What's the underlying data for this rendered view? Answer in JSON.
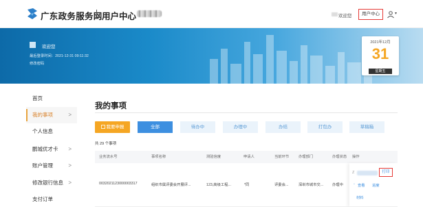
{
  "header": {
    "brand": "广东政务服务网",
    "section": "用户中心",
    "welcome": "欢迎您",
    "user_center_button": "用户中心",
    "caret": "▾"
  },
  "banner": {
    "greeting": "欢迎您",
    "last_login": "最后登录时间：2021-12-31 09:11:32",
    "change_password": "修改密码",
    "calendar": {
      "month": "2021年12月",
      "day": "31",
      "weekday": "星期五"
    }
  },
  "sidebar": {
    "items": [
      {
        "label": "首页",
        "arrow": ""
      },
      {
        "label": "我的事项",
        "arrow": ">"
      },
      {
        "label": "个人信息",
        "arrow": ""
      },
      {
        "label": "鹏城优才卡",
        "arrow": ">"
      },
      {
        "label": "账户管理",
        "arrow": ">"
      },
      {
        "label": "修改银行信息",
        "arrow": ">"
      },
      {
        "label": "支付订单",
        "arrow": ""
      }
    ]
  },
  "main": {
    "title": "我的事项",
    "tabs": [
      {
        "label": "我要申报"
      },
      {
        "label": "全部"
      },
      {
        "label": "待办中"
      },
      {
        "label": "办理中"
      },
      {
        "label": "办结"
      },
      {
        "label": "打包办"
      },
      {
        "label": "草稿箱"
      }
    ],
    "count": "共 29 个事项",
    "table": {
      "headers": [
        "业务流水号",
        "事项名称",
        "测验信度",
        "申请人",
        "当前环节",
        "办理部门",
        "办理状态",
        "操作"
      ],
      "row": {
        "serial": "0032021123000003317",
        "name": "组织市属评委会开展评...",
        "info": "123,高级工程...",
        "applicant": "*同",
        "stage": "评委会...",
        "dept": "深圳市城市交...",
        "status": "办理中",
        "ops": {
          "print": "打印",
          "view": "查看",
          "progress": "进度",
          "materials": "材料",
          "x": "Z"
        }
      }
    }
  },
  "colors": {
    "accent_orange": "#f5a623",
    "accent_blue": "#3d8fe0",
    "highlight_red": "#e53935"
  }
}
